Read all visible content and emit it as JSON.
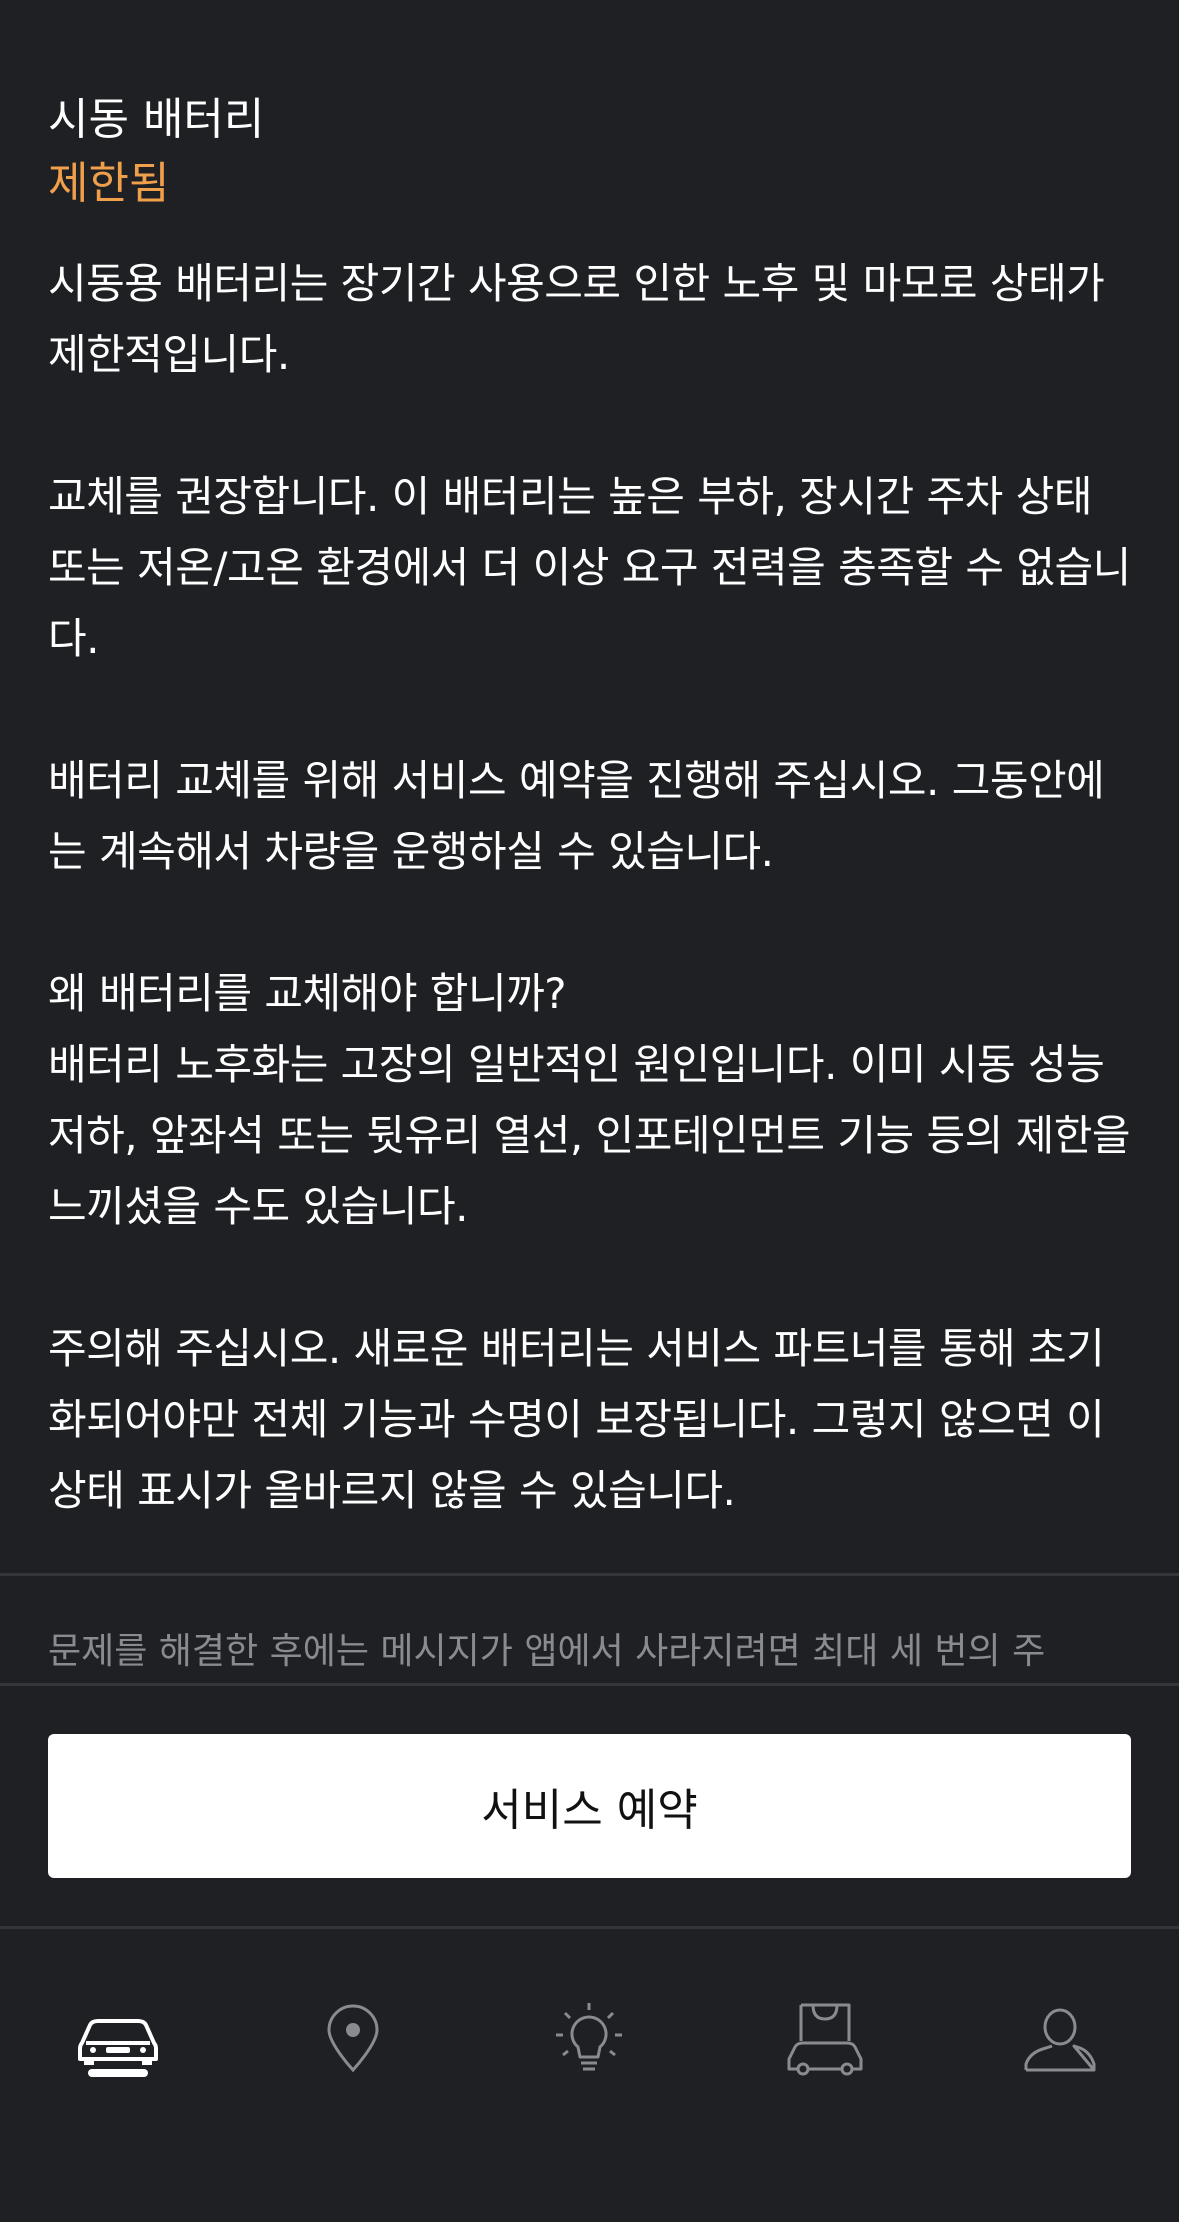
{
  "header": {
    "title": "시동 배터리",
    "status": "제한됨",
    "status_color": "#f0a04b"
  },
  "body": {
    "text": "시동용 배터리는 장기간 사용으로 인한 노후 및 마모로 상태가 제한적입니다.\n\n교체를 권장합니다. 이 배터리는 높은 부하, 장시간 주차 상태 또는 저온/고온 환경에서 더 이상 요구 전력을 충족할 수 없습니다.\n\n배터리 교체를 위해 서비스 예약을 진행해 주십시오. 그동안에는 계속해서 차량을 운행하실 수 있습니다.\n\n왜 배터리를 교체해야 합니까?\n배터리 노후화는 고장의 일반적인 원인입니다. 이미 시동 성능 저하, 앞좌석 또는 뒷유리 열선, 인포테인먼트 기능 등의 제한을 느끼셨을 수도 있습니다.\n\n주의해 주십시오. 새로운 배터리는 서비스 파트너를 통해 초기화되어야만 전체 기능과 수명이 보장됩니다. 그렇지 않으면 이 상태 표시가 올바르지 않을 수 있습니다."
  },
  "footnote": "문제를 해결한 후에는 메시지가 앱에서 사라지려면 최대 세 번의 주",
  "cta": {
    "label": "서비스 예약"
  },
  "tabbar": {
    "items": [
      {
        "icon": "car-icon",
        "active": true
      },
      {
        "icon": "location-pin-icon",
        "active": false
      },
      {
        "icon": "lightbulb-icon",
        "active": false
      },
      {
        "icon": "shop-car-icon",
        "active": false
      },
      {
        "icon": "profile-icon",
        "active": false
      }
    ]
  }
}
